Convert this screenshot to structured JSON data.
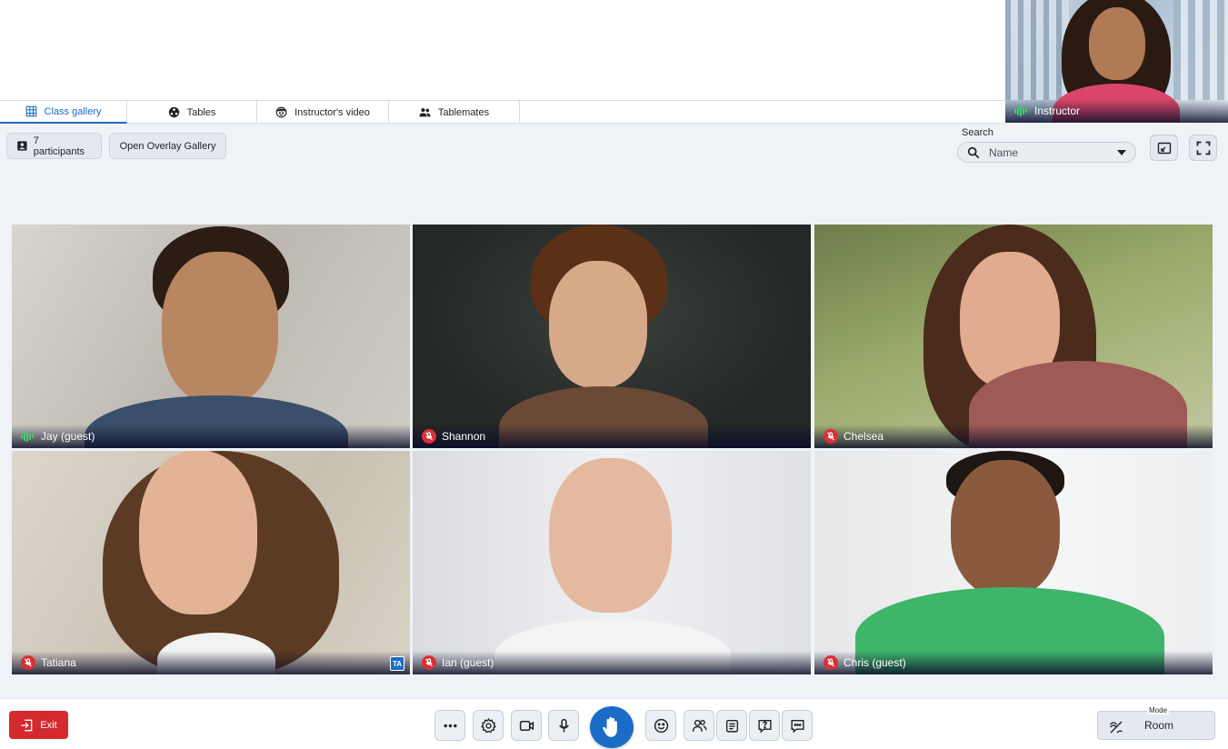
{
  "tabs": [
    {
      "label": "Class gallery",
      "icon": "grid-icon",
      "active": true
    },
    {
      "label": "Tables",
      "icon": "tables-icon",
      "active": false
    },
    {
      "label": "Instructor's video",
      "icon": "face-icon",
      "active": false
    },
    {
      "label": "Tablemates",
      "icon": "people-icon",
      "active": false
    }
  ],
  "instructor": {
    "name": "Instructor",
    "status": "speaking"
  },
  "toolbar": {
    "participants_label": "7 participants",
    "overlay_label": "Open Overlay Gallery",
    "search_label": "Search",
    "search_value": "Name"
  },
  "participants": [
    {
      "name": "Jay (guest)",
      "mic": "speaking",
      "active_speaker": true
    },
    {
      "name": "Shannon",
      "mic": "muted"
    },
    {
      "name": "Chelsea",
      "mic": "muted"
    },
    {
      "name": "Tatiana",
      "mic": "muted",
      "badge": "TA"
    },
    {
      "name": "Ian (guest)",
      "mic": "muted"
    },
    {
      "name": "Chris (guest)",
      "mic": "muted"
    }
  ],
  "bottom": {
    "exit_label": "Exit",
    "mode_label": "Mode",
    "mode_value": "Room",
    "buttons": [
      "more-icon",
      "settings-icon",
      "camera-icon",
      "mic-icon",
      "raise-hand-icon",
      "emoji-icon",
      "participants-icon",
      "notes-icon",
      "question-icon",
      "chat-icon"
    ]
  },
  "colors": {
    "accent": "#1a6cc7",
    "exit": "#d42a2f",
    "muted": "#d93036",
    "speaking": "#3ecf6a"
  }
}
